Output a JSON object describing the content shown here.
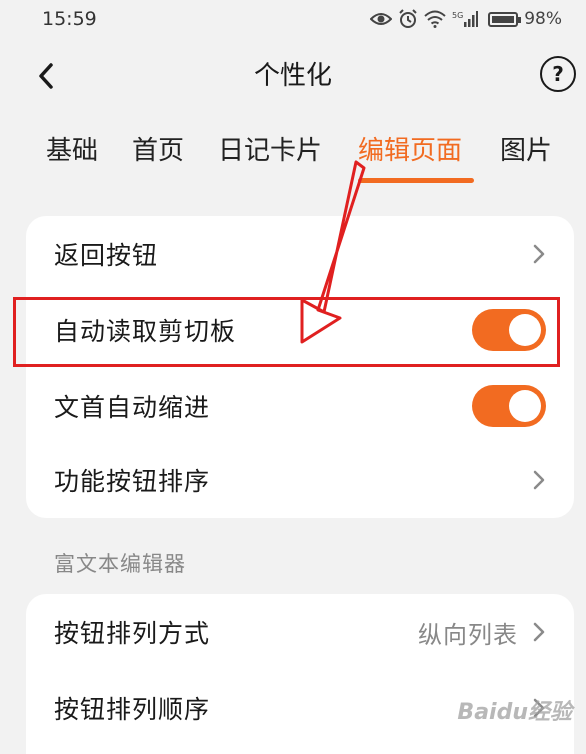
{
  "status_bar": {
    "time": "15:59",
    "network": "5G",
    "battery_level": 0.98,
    "battery_percent": "98%"
  },
  "header": {
    "title": "个性化",
    "help_label": "?"
  },
  "tabs": [
    {
      "label": "基础",
      "active": false
    },
    {
      "label": "首页",
      "active": false
    },
    {
      "label": "日记卡片",
      "active": false
    },
    {
      "label": "编辑页面",
      "active": true
    },
    {
      "label": "图片",
      "active": false
    }
  ],
  "settings": {
    "rows": [
      {
        "label": "返回按钮",
        "control": "chevron"
      },
      {
        "label": "自动读取剪切板",
        "control": "toggle",
        "on": true
      },
      {
        "label": "文首自动缩进",
        "control": "toggle",
        "on": true
      },
      {
        "label": "功能按钮排序",
        "control": "chevron"
      }
    ]
  },
  "rich_text": {
    "section_title": "富文本编辑器",
    "rows": [
      {
        "label": "按钮排列方式",
        "value": "纵向列表",
        "control": "chevron"
      },
      {
        "label": "按钮排列顺序",
        "control": "chevron"
      }
    ]
  },
  "watermark": "Baidu经验",
  "colors": {
    "accent": "#f26b21",
    "background": "#f2f2f2",
    "card": "#ffffff",
    "annotation": "#e02020"
  }
}
